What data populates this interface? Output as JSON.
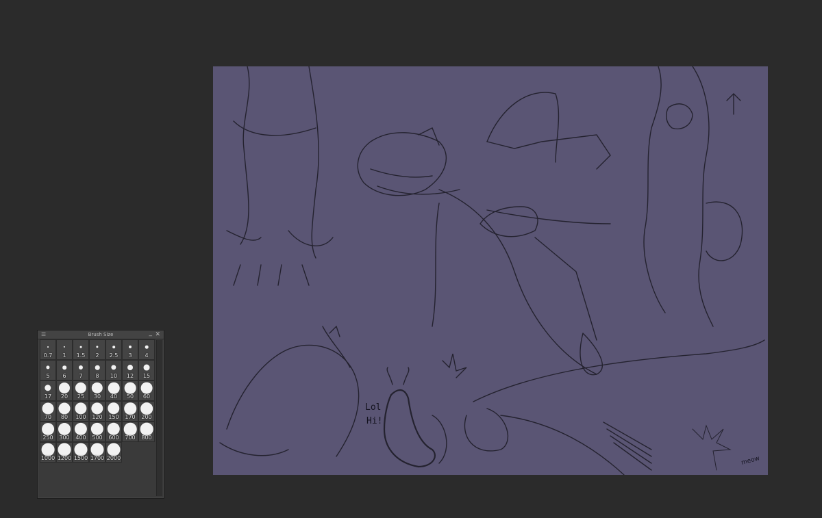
{
  "panel": {
    "title": "Brush Size",
    "menu_glyph": "☰",
    "minimize_glyph": "_",
    "close_glyph": "✕",
    "sizes": [
      "0.7",
      "1",
      "1.5",
      "2",
      "2.5",
      "3",
      "4",
      "5",
      "6",
      "7",
      "8",
      "10",
      "12",
      "15",
      "17",
      "20",
      "25",
      "30",
      "40",
      "50",
      "60",
      "70",
      "80",
      "100",
      "120",
      "150",
      "170",
      "200",
      "250",
      "300",
      "400",
      "500",
      "600",
      "700",
      "800",
      "1000",
      "1200",
      "1500",
      "1700",
      "2000"
    ]
  },
  "canvas": {
    "background": "#5a5574",
    "doodle_text_1": "Lol",
    "doodle_text_2": "Hi!",
    "doodle_text_3": "meow"
  }
}
